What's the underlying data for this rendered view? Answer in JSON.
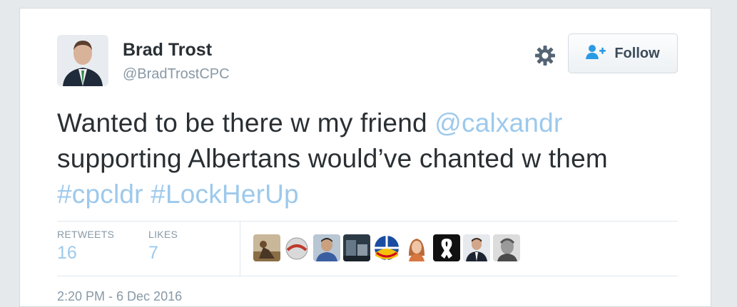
{
  "author": {
    "name": "Brad Trost",
    "handle": "@BradTrostCPC"
  },
  "follow_button": {
    "label": "Follow"
  },
  "tweet": {
    "text_part1": "Wanted to be there w my friend ",
    "mention": "@calxandr",
    "text_part2": "supporting Albertans would’ve chanted w them",
    "hashtag1": "#cpcldr",
    "hashtag2": "#LockHerUp"
  },
  "stats": {
    "retweets_label": "RETWEETS",
    "retweets_value": "16",
    "likes_label": "LIKES",
    "likes_value": "7"
  },
  "timestamp": "2:20 PM - 6 Dec 2016",
  "colors": {
    "link": "#9dc9ec",
    "text": "#292f33",
    "muted": "#8899a6"
  }
}
